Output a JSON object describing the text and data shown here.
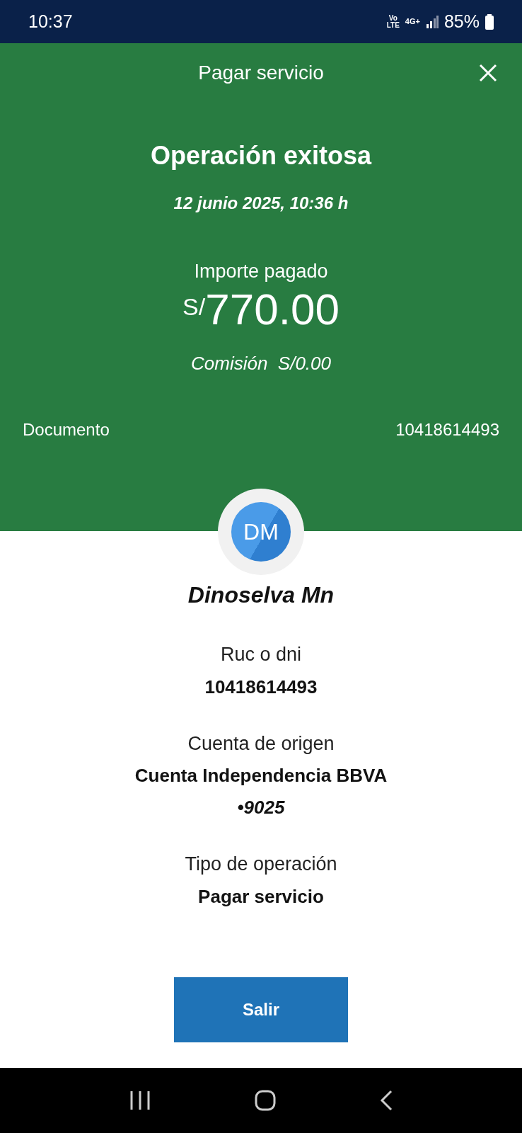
{
  "status_bar": {
    "time": "10:37",
    "voice": [
      "Vo",
      "LTE"
    ],
    "network": "4G+",
    "battery": "85%"
  },
  "header": {
    "title": "Pagar servicio"
  },
  "result": {
    "title": "Operación exitosa",
    "date": "12 junio 2025, 10:36 h",
    "amount_label": "Importe pagado",
    "currency": "S/",
    "amount": "770.00",
    "fee": "Comisión  S/0.00"
  },
  "document": {
    "label": "Documento",
    "value": "10418614493"
  },
  "payee": {
    "initials": "DM",
    "name": "Dinoselva Mn"
  },
  "details": [
    {
      "label": "Ruc o dni",
      "value": "10418614493"
    },
    {
      "label": "Cuenta de origen",
      "value": "Cuenta Independencia BBVA",
      "suffix": "•9025"
    },
    {
      "label": "Tipo de operación",
      "value": "Pagar servicio"
    }
  ],
  "buttons": [
    "Salir"
  ]
}
